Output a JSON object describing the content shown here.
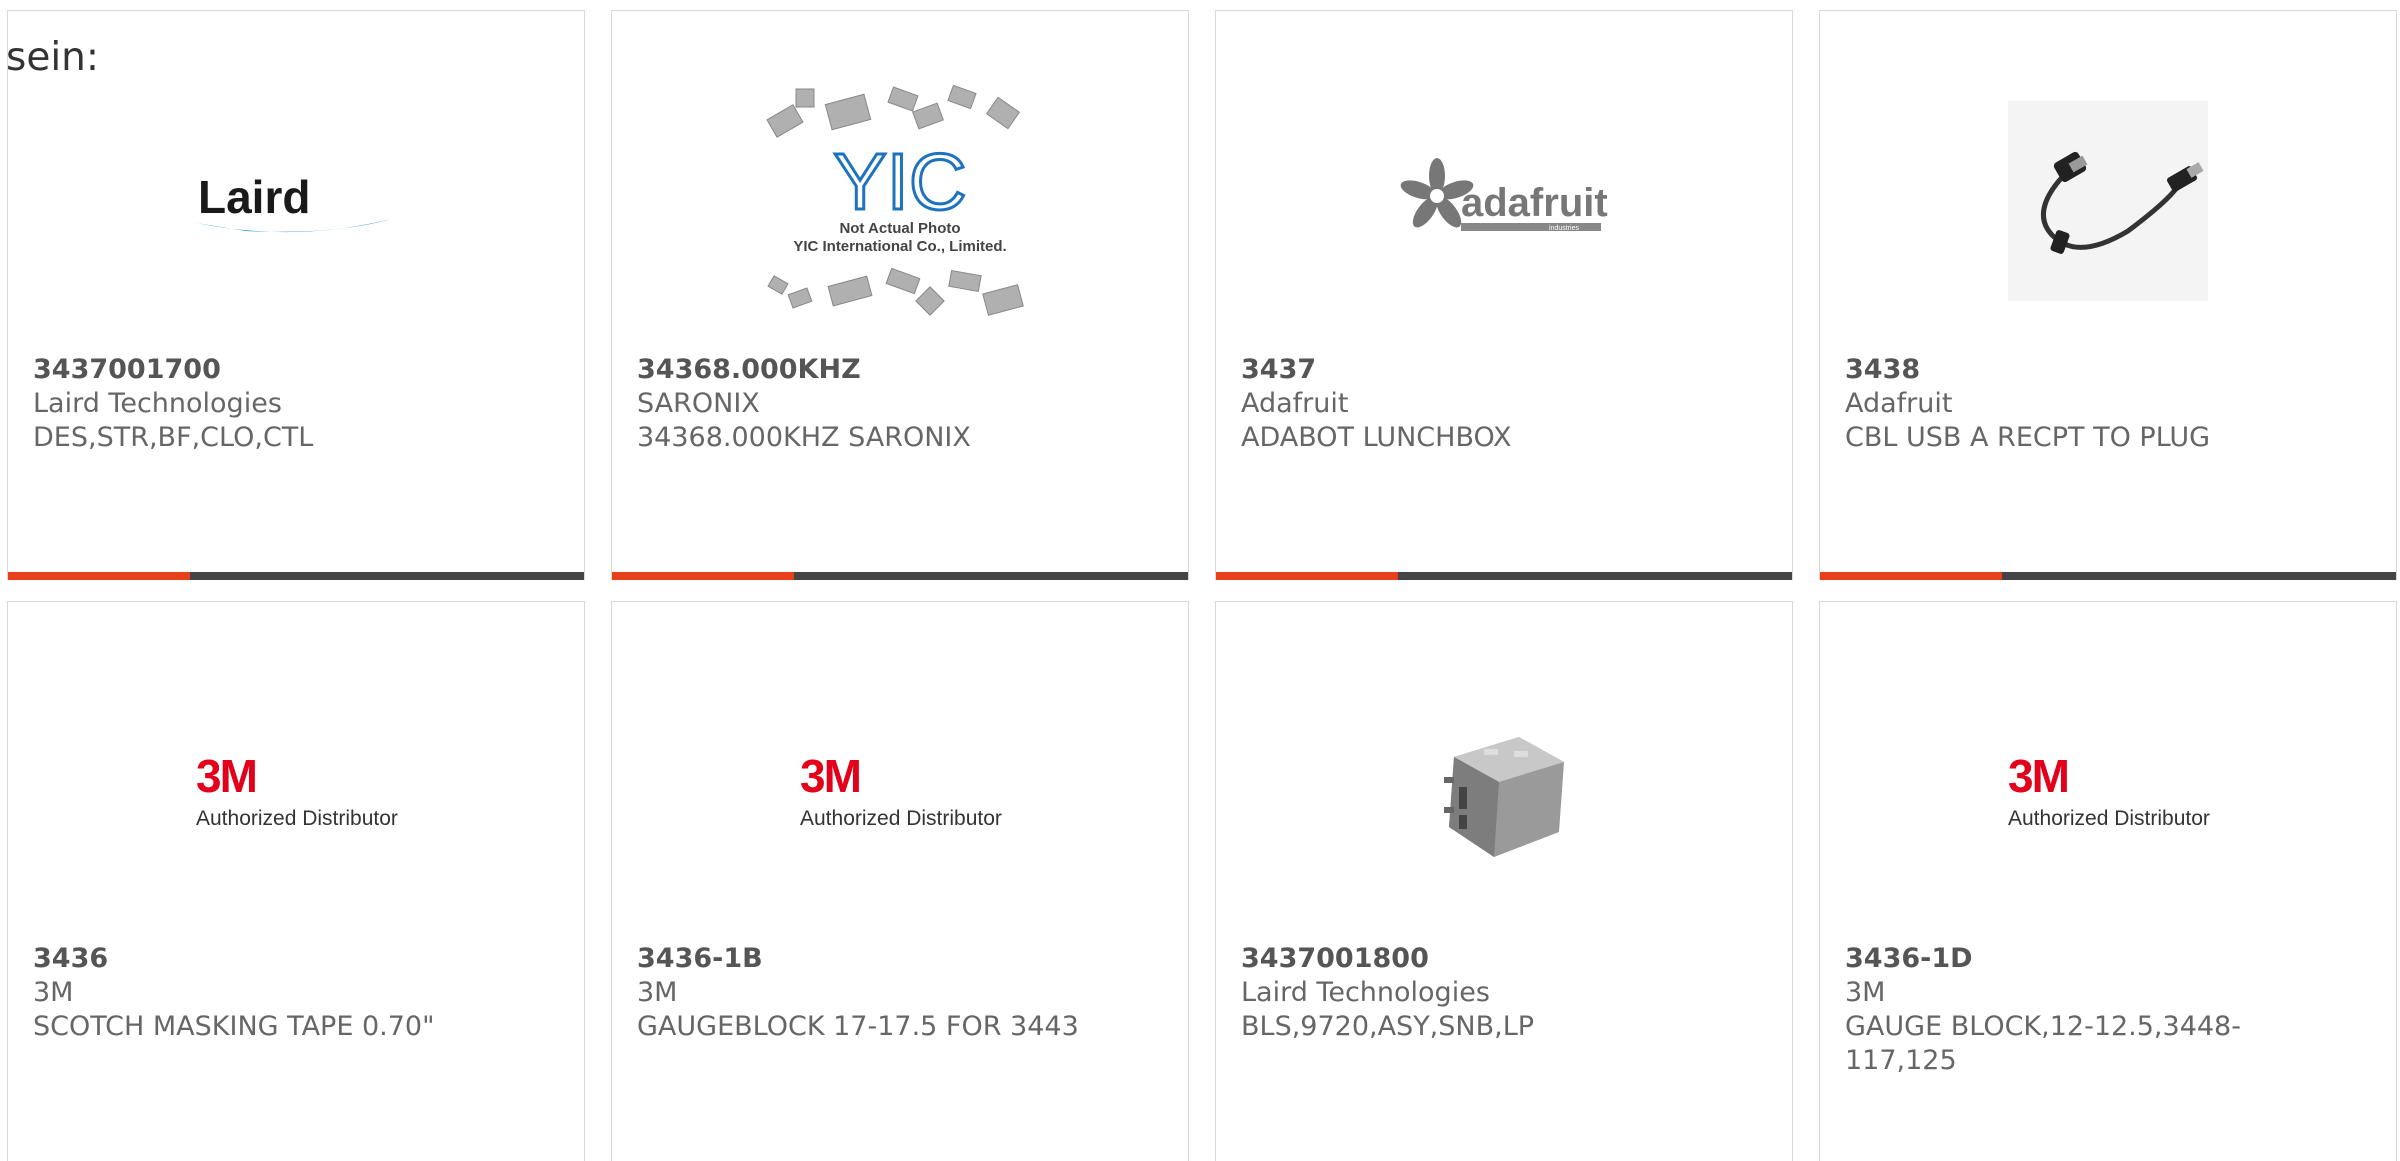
{
  "intro_text": "sein:",
  "brand": {
    "accent": "#e8401c",
    "bar_dark": "#444444"
  },
  "products": [
    {
      "part": "3437001700",
      "manufacturer": "Laird Technologies",
      "description": "DES,STR,BF,CLO,CTL",
      "image": "laird-logo",
      "logo_text": "Laird"
    },
    {
      "part": "34368.000KHZ",
      "manufacturer": "SARONIX",
      "description": "34368.000KHZ SARONIX",
      "image": "yic-placeholder",
      "logo_text": "YIC",
      "photo_note1": "Not Actual Photo",
      "photo_note2": "YIC International Co., Limited."
    },
    {
      "part": "3437",
      "manufacturer": "Adafruit",
      "description": "ADABOT LUNCHBOX",
      "image": "adafruit-logo",
      "logo_text": "adafruit",
      "logo_sub": "industries"
    },
    {
      "part": "3438",
      "manufacturer": "Adafruit",
      "description": "CBL USB A RECPT TO PLUG",
      "image": "usb-cable-photo"
    },
    {
      "part": "3436",
      "manufacturer": "3M",
      "description": "SCOTCH MASKING TAPE 0.70\"",
      "image": "3m-logo",
      "logo_text": "3M",
      "logo_sub": "Authorized Distributor"
    },
    {
      "part": "3436-1B",
      "manufacturer": "3M",
      "description": "GAUGEBLOCK 17-17.5 FOR 3443",
      "image": "3m-logo",
      "logo_text": "3M",
      "logo_sub": "Authorized Distributor"
    },
    {
      "part": "3437001800",
      "manufacturer": "Laird Technologies",
      "description": "BLS,9720,ASY,SNB,LP",
      "image": "shield-can-photo"
    },
    {
      "part": "3436-1D",
      "manufacturer": "3M",
      "description": "GAUGE BLOCK,12-12.5,3448-117,125",
      "image": "3m-logo",
      "logo_text": "3M",
      "logo_sub": "Authorized Distributor"
    }
  ]
}
